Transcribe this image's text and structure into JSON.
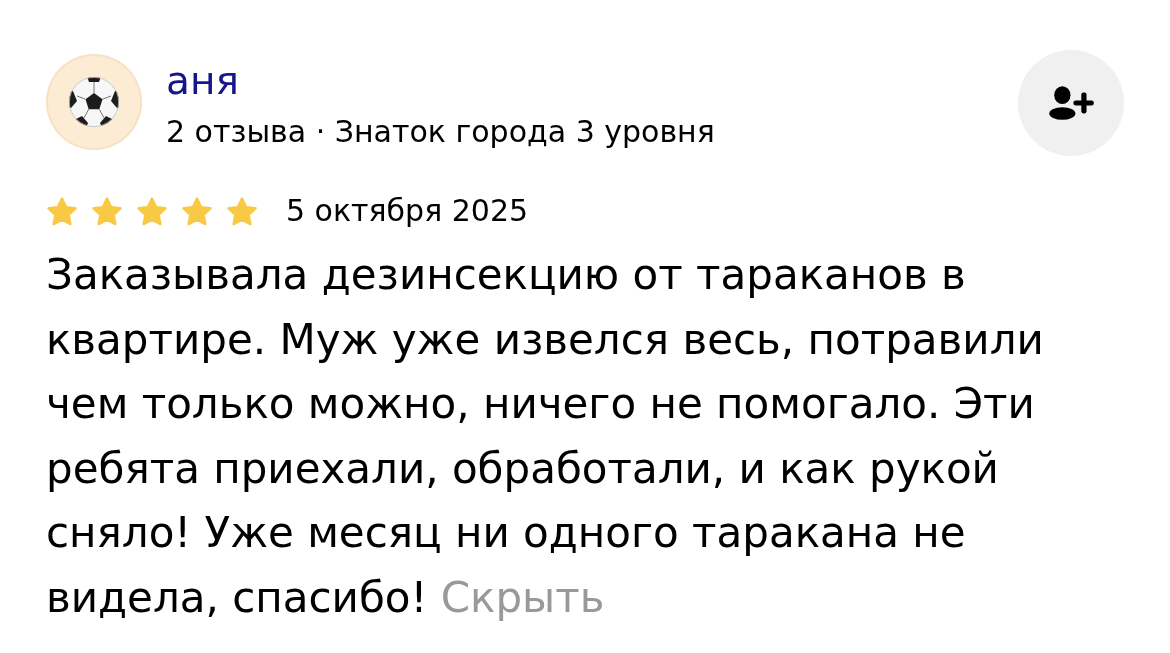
{
  "author": {
    "name": "аня",
    "meta": "2 отзыва · Знаток города 3 уровня"
  },
  "rating": {
    "stars": 5,
    "date": "5 октября 2025"
  },
  "review": {
    "text": "Заказывала дезинсекцию от тараканов в квартире. Муж уже извелся весь, потравили чем только можно, ничего не помогало. Эти ребята приехали, обработали, и как рукой сняло! Уже месяц ни одного таракана не видела, спасибо!",
    "hide_link": "Скрыть"
  }
}
